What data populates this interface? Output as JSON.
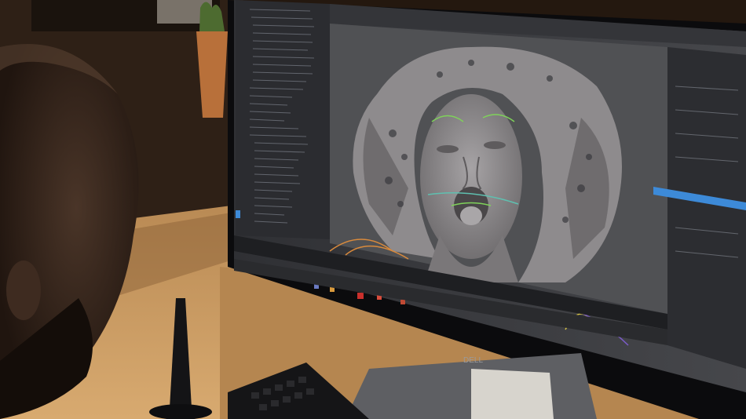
{
  "scene": {
    "description_tags": [
      "office-desk",
      "computer-monitor",
      "3d-modeling-software",
      "person-viewing"
    ],
    "monitor_brand": "DELL"
  },
  "colors": {
    "wall": "#2a1d14",
    "desk": "#c79a62",
    "desk_shadow": "#7a5634",
    "monitor_bezel": "#0d0d0f",
    "screen_bg": "#3b3c40",
    "viewport_bg": "#555659",
    "model_gray": "#8d8a8c",
    "accent_blue": "#3d8ad8",
    "curve_green": "#7fd25a",
    "curve_orange": "#d98a3c",
    "curve_yellow": "#d7c244",
    "skin": "#3a2a20"
  },
  "icons": [
    "plant-pot-icon",
    "stylus-icon",
    "keyboard-icon",
    "monitor-stand-icon"
  ]
}
